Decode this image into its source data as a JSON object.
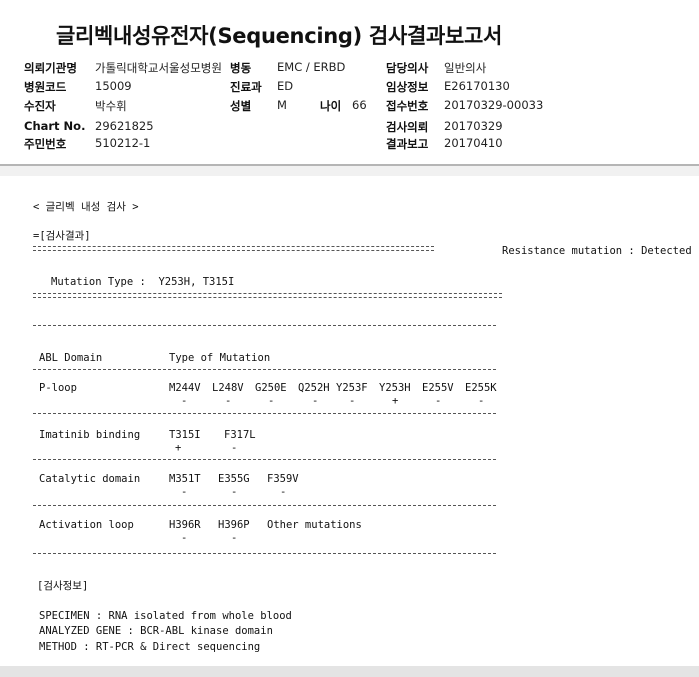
{
  "report": {
    "title": "글리벡내성유전자(Sequencing) 검사결과보고서"
  },
  "patient": {
    "institution_label": "의뢰기관명",
    "institution_value": "가톨릭대학교서울성모병원",
    "ward_label": "병동",
    "ward_value": "EMC / ERBD",
    "doctor_label": "담당의사",
    "doctor_value": "일반의사",
    "hospital_code_label": "병원코드",
    "hospital_code_value": "15009",
    "department_label": "진료과",
    "department_value": "ED",
    "clinical_info_label": "임상정보",
    "clinical_info_value": "E26170130",
    "patient_label": "수진자",
    "patient_value": "박수휘",
    "sex_label": "성별",
    "sex_value": "M",
    "age_label": "나이",
    "age_value": "66",
    "receipt_no_label": "접수번호",
    "receipt_no_value": "20170329-00033",
    "chart_no_label": "Chart No.",
    "chart_no_value": "29621825",
    "request_date_label": "검사의뢰",
    "request_date_value": "20170329",
    "resident_no_label": "주민번호",
    "resident_no_value": "510212-1",
    "report_date_label": "결과보고",
    "report_date_value": "20170410"
  },
  "result": {
    "section_title": "< 글리벡 내성 검사 >",
    "result_header": "=[검사결과]",
    "resistance": "Resistance mutation : Detected",
    "mutation_type": "Mutation Type :  Y253H, T315I",
    "col_domain": "ABL Domain",
    "col_type": "Type of Mutation",
    "domains": [
      {
        "name": "P-loop",
        "mutations": [
          {
            "code": "M244V",
            "mark": "-"
          },
          {
            "code": "L248V",
            "mark": "-"
          },
          {
            "code": "G250E",
            "mark": "-"
          },
          {
            "code": "Q252H",
            "mark": "-"
          },
          {
            "code": "Y253F",
            "mark": "-"
          },
          {
            "code": "Y253H",
            "mark": "+"
          },
          {
            "code": "E255V",
            "mark": "-"
          },
          {
            "code": "E255K",
            "mark": "-"
          }
        ]
      },
      {
        "name": "Imatinib binding",
        "mutations": [
          {
            "code": "T315I",
            "mark": "+"
          },
          {
            "code": "F317L",
            "mark": "-"
          }
        ]
      },
      {
        "name": "Catalytic domain",
        "mutations": [
          {
            "code": "M351T",
            "mark": "-"
          },
          {
            "code": "E355G",
            "mark": "-"
          },
          {
            "code": "F359V",
            "mark": "-"
          }
        ]
      },
      {
        "name": "Activation loop",
        "mutations": [
          {
            "code": "H396R",
            "mark": "-"
          },
          {
            "code": "H396P",
            "mark": "-"
          },
          {
            "code": "Other mutations",
            "mark": ""
          }
        ]
      }
    ]
  },
  "info": {
    "header": "[검사정보]",
    "specimen": "SPECIMEN : RNA isolated from whole blood",
    "gene": "ANALYZED GENE : BCR-ABL kinase domain",
    "method": "METHOD : RT-PCR & Direct sequencing"
  }
}
